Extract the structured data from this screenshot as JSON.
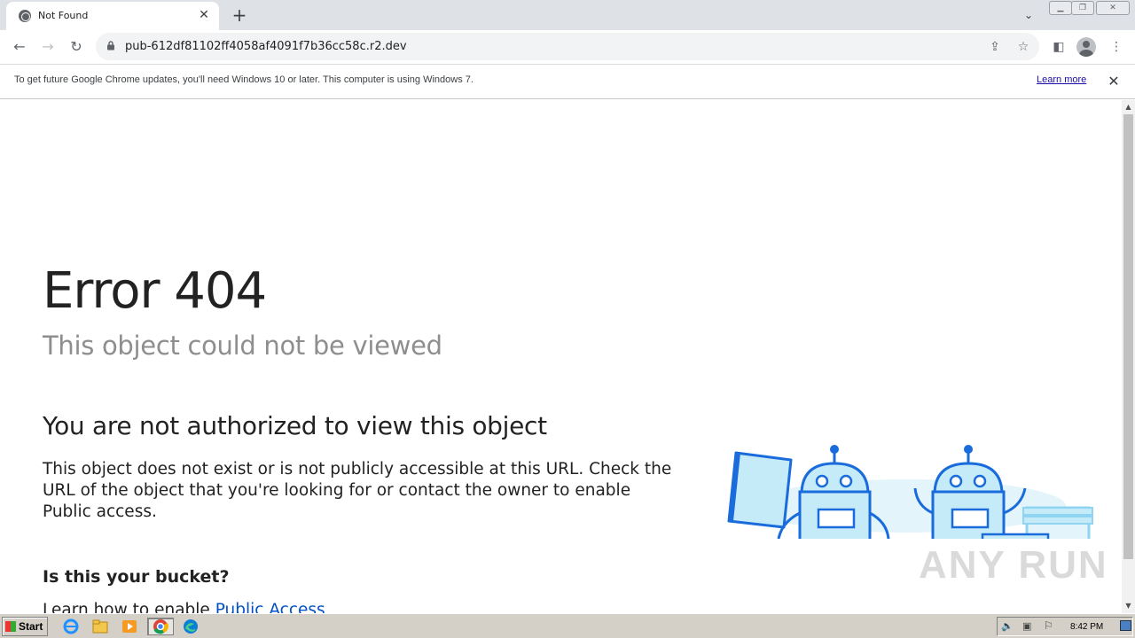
{
  "browser": {
    "tab_title": "Not Found",
    "url": "pub-612df81102ff4058af4091f7b36cc58c.r2.dev",
    "infobar_text": "To get future Google Chrome updates, you'll need Windows 10 or later. This computer is using Windows 7.",
    "infobar_link": "Learn more",
    "icons": [
      "globe-icon",
      "close-icon",
      "plus-icon",
      "chevron-down-icon",
      "back-icon",
      "forward-icon",
      "reload-icon",
      "lock-icon",
      "share-icon",
      "star-icon",
      "sidepanel-icon",
      "profile-icon",
      "kebab-menu-icon"
    ]
  },
  "page": {
    "title": "Error 404",
    "subtitle": "This object could not be viewed",
    "heading": "You are not authorized to view this object",
    "body": "This object does not exist or is not publicly accessible at this URL. Check the URL of the object that you're looking for or contact the owner to enable Public access.",
    "bucket_heading": "Is this your bucket?",
    "learn_prefix": "Learn how to enable ",
    "learn_link": "Public Access"
  },
  "watermark": "ANY RUN",
  "taskbar": {
    "start_label": "Start",
    "clock": "8:42 PM"
  }
}
